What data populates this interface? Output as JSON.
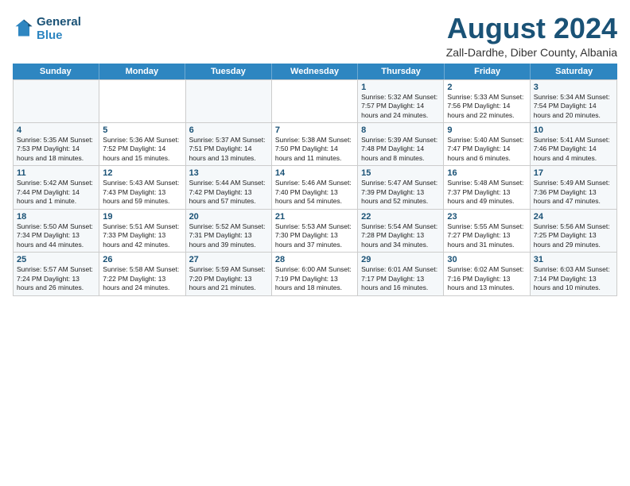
{
  "header": {
    "logo_line1": "General",
    "logo_line2": "Blue",
    "title": "August 2024",
    "subtitle": "Zall-Dardhe, Diber County, Albania"
  },
  "weekdays": [
    "Sunday",
    "Monday",
    "Tuesday",
    "Wednesday",
    "Thursday",
    "Friday",
    "Saturday"
  ],
  "rows": [
    [
      {
        "day": "",
        "info": ""
      },
      {
        "day": "",
        "info": ""
      },
      {
        "day": "",
        "info": ""
      },
      {
        "day": "",
        "info": ""
      },
      {
        "day": "1",
        "info": "Sunrise: 5:32 AM\nSunset: 7:57 PM\nDaylight: 14 hours\nand 24 minutes."
      },
      {
        "day": "2",
        "info": "Sunrise: 5:33 AM\nSunset: 7:56 PM\nDaylight: 14 hours\nand 22 minutes."
      },
      {
        "day": "3",
        "info": "Sunrise: 5:34 AM\nSunset: 7:54 PM\nDaylight: 14 hours\nand 20 minutes."
      }
    ],
    [
      {
        "day": "4",
        "info": "Sunrise: 5:35 AM\nSunset: 7:53 PM\nDaylight: 14 hours\nand 18 minutes."
      },
      {
        "day": "5",
        "info": "Sunrise: 5:36 AM\nSunset: 7:52 PM\nDaylight: 14 hours\nand 15 minutes."
      },
      {
        "day": "6",
        "info": "Sunrise: 5:37 AM\nSunset: 7:51 PM\nDaylight: 14 hours\nand 13 minutes."
      },
      {
        "day": "7",
        "info": "Sunrise: 5:38 AM\nSunset: 7:50 PM\nDaylight: 14 hours\nand 11 minutes."
      },
      {
        "day": "8",
        "info": "Sunrise: 5:39 AM\nSunset: 7:48 PM\nDaylight: 14 hours\nand 8 minutes."
      },
      {
        "day": "9",
        "info": "Sunrise: 5:40 AM\nSunset: 7:47 PM\nDaylight: 14 hours\nand 6 minutes."
      },
      {
        "day": "10",
        "info": "Sunrise: 5:41 AM\nSunset: 7:46 PM\nDaylight: 14 hours\nand 4 minutes."
      }
    ],
    [
      {
        "day": "11",
        "info": "Sunrise: 5:42 AM\nSunset: 7:44 PM\nDaylight: 14 hours\nand 1 minute."
      },
      {
        "day": "12",
        "info": "Sunrise: 5:43 AM\nSunset: 7:43 PM\nDaylight: 13 hours\nand 59 minutes."
      },
      {
        "day": "13",
        "info": "Sunrise: 5:44 AM\nSunset: 7:42 PM\nDaylight: 13 hours\nand 57 minutes."
      },
      {
        "day": "14",
        "info": "Sunrise: 5:46 AM\nSunset: 7:40 PM\nDaylight: 13 hours\nand 54 minutes."
      },
      {
        "day": "15",
        "info": "Sunrise: 5:47 AM\nSunset: 7:39 PM\nDaylight: 13 hours\nand 52 minutes."
      },
      {
        "day": "16",
        "info": "Sunrise: 5:48 AM\nSunset: 7:37 PM\nDaylight: 13 hours\nand 49 minutes."
      },
      {
        "day": "17",
        "info": "Sunrise: 5:49 AM\nSunset: 7:36 PM\nDaylight: 13 hours\nand 47 minutes."
      }
    ],
    [
      {
        "day": "18",
        "info": "Sunrise: 5:50 AM\nSunset: 7:34 PM\nDaylight: 13 hours\nand 44 minutes."
      },
      {
        "day": "19",
        "info": "Sunrise: 5:51 AM\nSunset: 7:33 PM\nDaylight: 13 hours\nand 42 minutes."
      },
      {
        "day": "20",
        "info": "Sunrise: 5:52 AM\nSunset: 7:31 PM\nDaylight: 13 hours\nand 39 minutes."
      },
      {
        "day": "21",
        "info": "Sunrise: 5:53 AM\nSunset: 7:30 PM\nDaylight: 13 hours\nand 37 minutes."
      },
      {
        "day": "22",
        "info": "Sunrise: 5:54 AM\nSunset: 7:28 PM\nDaylight: 13 hours\nand 34 minutes."
      },
      {
        "day": "23",
        "info": "Sunrise: 5:55 AM\nSunset: 7:27 PM\nDaylight: 13 hours\nand 31 minutes."
      },
      {
        "day": "24",
        "info": "Sunrise: 5:56 AM\nSunset: 7:25 PM\nDaylight: 13 hours\nand 29 minutes."
      }
    ],
    [
      {
        "day": "25",
        "info": "Sunrise: 5:57 AM\nSunset: 7:24 PM\nDaylight: 13 hours\nand 26 minutes."
      },
      {
        "day": "26",
        "info": "Sunrise: 5:58 AM\nSunset: 7:22 PM\nDaylight: 13 hours\nand 24 minutes."
      },
      {
        "day": "27",
        "info": "Sunrise: 5:59 AM\nSunset: 7:20 PM\nDaylight: 13 hours\nand 21 minutes."
      },
      {
        "day": "28",
        "info": "Sunrise: 6:00 AM\nSunset: 7:19 PM\nDaylight: 13 hours\nand 18 minutes."
      },
      {
        "day": "29",
        "info": "Sunrise: 6:01 AM\nSunset: 7:17 PM\nDaylight: 13 hours\nand 16 minutes."
      },
      {
        "day": "30",
        "info": "Sunrise: 6:02 AM\nSunset: 7:16 PM\nDaylight: 13 hours\nand 13 minutes."
      },
      {
        "day": "31",
        "info": "Sunrise: 6:03 AM\nSunset: 7:14 PM\nDaylight: 13 hours\nand 10 minutes."
      }
    ]
  ]
}
